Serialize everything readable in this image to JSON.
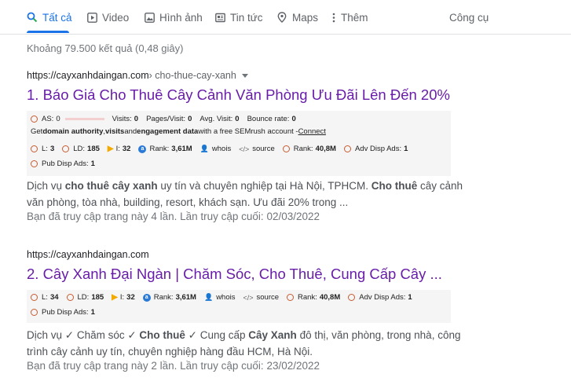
{
  "tabs": {
    "all": "Tất cả",
    "video": "Video",
    "images": "Hình ảnh",
    "news": "Tin tức",
    "maps": "Maps",
    "more": "Thêm",
    "tools": "Công cụ"
  },
  "stats": "Khoảng 79.500 kết quả (0,48 giây)",
  "colors": {
    "accent": "#1a73e8",
    "visited_link": "#681da8",
    "seo_circle": "#c95b30"
  },
  "results": [
    {
      "url": "https://cayxanhdaingan.com",
      "path": " › cho-thue-cay-xanh",
      "title": "1. Báo Giá Cho Thuê Cây Cảnh Văn Phòng Ưu Đãi Lên Đến 20%",
      "seo_line1": {
        "as_label": "AS:",
        "as_value": "0",
        "visits_label": "Visits:",
        "visits_value": "0",
        "pages_label": "Pages/Visit:",
        "pages_value": "0",
        "avg_label": "Avg. Visit:",
        "avg_value": "0",
        "bounce_label": "Bounce rate:",
        "bounce_value": "0"
      },
      "seo_line2": {
        "t1": "Get ",
        "b1": "domain authority",
        "t2": ", ",
        "b2": "visits",
        "t3": " and ",
        "b3": "engagement data",
        "t4": " with a free SEMrush account - ",
        "link": "Connect"
      },
      "metrics": {
        "l_label": "L:",
        "l_value": "3",
        "ld_label": "LD:",
        "ld_value": "185",
        "i_label": "I:",
        "i_value": "32",
        "rank_label": "Rank:",
        "rank_value": "3,61M",
        "whois": "whois",
        "source": "source",
        "rank2_label": "Rank:",
        "rank2_value": "40,8M",
        "adv_label": "Adv Disp Ads:",
        "adv_value": "1",
        "pub_label": "Pub Disp Ads:",
        "pub_value": "1"
      },
      "snippet": {
        "p1": "Dịch vụ ",
        "b1": "cho thuê cây xanh",
        "p2": " uy tín và chuyên nghiệp tại Hà Nội, TPHCM. ",
        "b2": "Cho thuê",
        "p3": " cây cảnh văn phòng, tòa nhà, building, resort, khách sạn. Ưu đãi 20% trong ..."
      },
      "visited": "Bạn đã truy cập trang này 4 lần. Lần truy cập cuối: 02/03/2022"
    },
    {
      "url": "https://cayxanhdaingan.com",
      "title": "2. Cây Xanh Đại Ngàn | Chăm Sóc, Cho Thuê, Cung Cấp Cây ...",
      "metrics": {
        "l_label": "L:",
        "l_value": "34",
        "ld_label": "LD:",
        "ld_value": "185",
        "i_label": "I:",
        "i_value": "32",
        "rank_label": "Rank:",
        "rank_value": "3,61M",
        "whois": "whois",
        "source": "source",
        "rank2_label": "Rank:",
        "rank2_value": "40,8M",
        "adv_label": "Adv Disp Ads:",
        "adv_value": "1",
        "pub_label": "Pub Disp Ads:",
        "pub_value": "1"
      },
      "snippet": {
        "p1": "Dịch vụ ✓ Chăm sóc ✓ ",
        "b1": "Cho thuê",
        "p2": " ✓ Cung cấp ",
        "b2": "Cây Xanh",
        "p3": " đô thị, văn phòng, trong nhà, công trình cây cảnh uy tín, chuyên nghiệp hàng đầu HCM, Hà Nội."
      },
      "visited": "Bạn đã truy cập trang này 2 lần. Lần truy cập cuối: 23/02/2022"
    }
  ]
}
